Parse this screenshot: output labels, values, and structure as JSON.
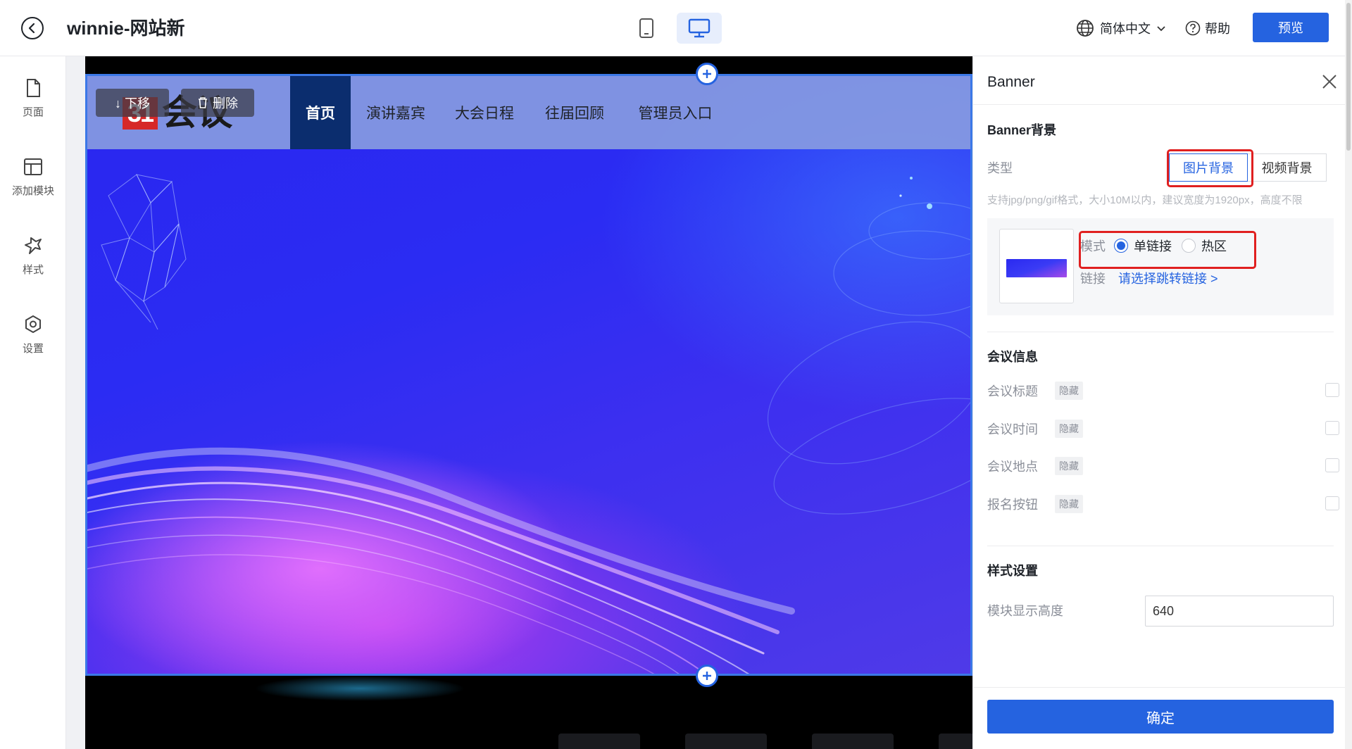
{
  "header": {
    "site_title": "winnie-网站新",
    "language": "简体中文",
    "help_label": "帮助",
    "preview_label": "预览"
  },
  "sidebar": {
    "items": [
      {
        "label": "页面",
        "icon": "page-icon"
      },
      {
        "label": "添加模块",
        "icon": "layout-icon"
      },
      {
        "label": "样式",
        "icon": "style-icon"
      },
      {
        "label": "设置",
        "icon": "settings-icon"
      }
    ]
  },
  "canvas": {
    "logo_badge": "31",
    "logo_text": "会议",
    "block_actions": {
      "move_down": "↓ 下移",
      "delete": "删除"
    },
    "nav": [
      "首页",
      "演讲嘉宾",
      "大会日程",
      "往届回顾",
      "管理员入口"
    ],
    "active_nav": "首页"
  },
  "panel": {
    "title": "Banner",
    "bg_section_title": "Banner背景",
    "type_label": "类型",
    "type_options": [
      "图片背景",
      "视频背景"
    ],
    "type_selected": "图片背景",
    "upload_hint": "支持jpg/png/gif格式，大小10M以内，建议宽度为1920px，高度不限",
    "mode_label": "模式",
    "mode_options": [
      "单链接",
      "热区"
    ],
    "mode_selected": "单链接",
    "link_label": "链接",
    "link_value": "请选择跳转链接 >",
    "info_section_title": "会议信息",
    "info_rows": [
      {
        "label": "会议标题",
        "tag": "隐藏"
      },
      {
        "label": "会议时间",
        "tag": "隐藏"
      },
      {
        "label": "会议地点",
        "tag": "隐藏"
      },
      {
        "label": "报名按钮",
        "tag": "隐藏"
      }
    ],
    "style_section_title": "样式设置",
    "height_label": "模块显示高度",
    "height_value": "640",
    "confirm_label": "确定"
  },
  "colors": {
    "primary": "#2563e0",
    "highlight": "#e02020",
    "nav_active": "#0b2d6e"
  }
}
